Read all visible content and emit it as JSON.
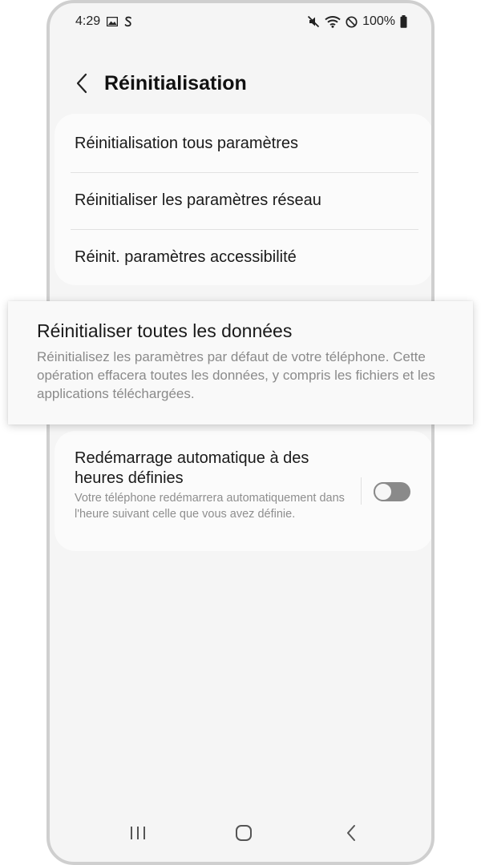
{
  "status_bar": {
    "time": "4:29",
    "battery": "100%",
    "icons": [
      "gallery-icon",
      "s-app-icon",
      "mute-icon",
      "wifi-icon",
      "do-not-disturb-icon",
      "battery-icon"
    ]
  },
  "header": {
    "title": "Réinitialisation",
    "back_icon": "chevron-left-icon"
  },
  "menu": {
    "items": [
      {
        "label": "Réinitialisation tous paramètres"
      },
      {
        "label": "Réinitialiser les paramètres réseau"
      },
      {
        "label": "Réinit. paramètres accessibilité"
      }
    ]
  },
  "highlight": {
    "title": "Réinitialiser toutes les données",
    "description": "Réinitialisez les paramètres par défaut de votre téléphone. Cette opération effacera toutes les données, y compris les fichiers et les applications téléchargées."
  },
  "auto_restart": {
    "title": "Redémarrage automatique à des heures définies",
    "description": "Votre téléphone redémarrera automatiquement dans l'heure suivant celle que vous avez définie.",
    "toggle_on": false
  },
  "navbar": {
    "icons": [
      "recents-icon",
      "home-icon",
      "back-icon"
    ]
  },
  "colors": {
    "background": "#f5f5f5",
    "card": "#fbfbfb",
    "secondary_text": "#8a8a8a",
    "toggle_off": "#8a8a8a"
  }
}
